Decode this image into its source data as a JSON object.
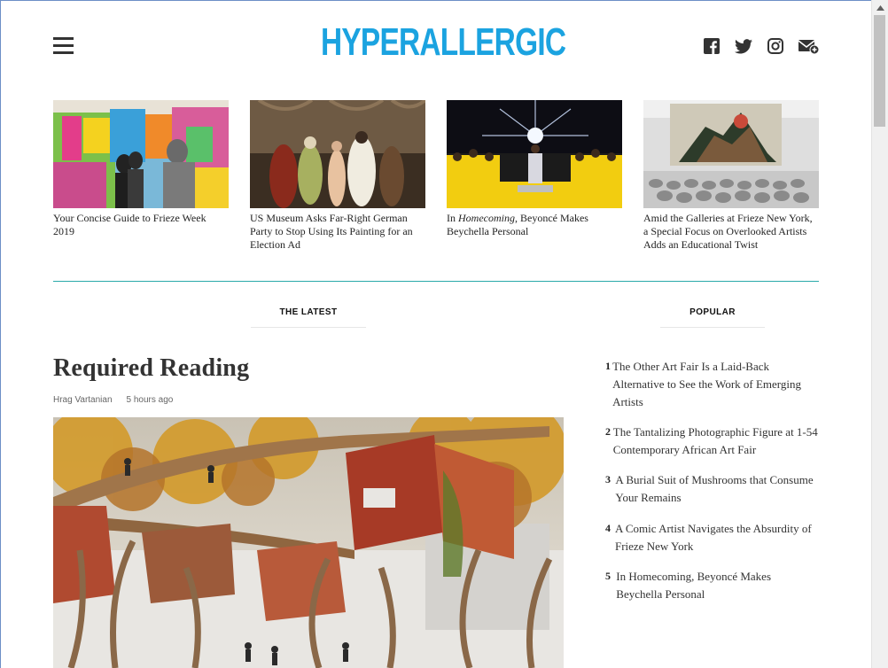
{
  "header": {
    "logo": "HYPERALLERGIC",
    "menu_icon": "hamburger-menu-icon",
    "social_icons": [
      "facebook-icon",
      "twitter-icon",
      "instagram-icon",
      "newsletter-icon"
    ]
  },
  "featured": [
    {
      "caption": "Your Concise Guide to Frieze Week 2019"
    },
    {
      "caption": "US Museum Asks Far-Right German Party to Stop Using Its Painting for an Election Ad"
    },
    {
      "caption_prefix": "In ",
      "caption_em": "Homecoming",
      "caption_suffix": ", Beyoncé Makes Beychella Personal"
    },
    {
      "caption": "Amid the Galleries at Frieze New York, a Special Focus on Overlooked Artists Adds an Educational Twist"
    }
  ],
  "tabs": {
    "latest": "THE LATEST",
    "popular": "POPULAR"
  },
  "latest": {
    "title": "Required Reading",
    "author": "Hrag Vartanian",
    "time": "5 hours ago"
  },
  "popular": [
    {
      "num": "1",
      "title": "The Other Art Fair Is a Laid-Back Alternative to See the Work of Emerging Artists"
    },
    {
      "num": "2",
      "title": "The Tantalizing Photographic Figure at 1-54 Contemporary African Art Fair"
    },
    {
      "num": "3",
      "title": "A Burial Suit of Mushrooms that Consume Your Remains"
    },
    {
      "num": "4",
      "title": "A Comic Artist Navigates the Absurdity of Frieze New York"
    },
    {
      "num": "5",
      "title": "In Homecoming, Beyoncé Makes Beychella Personal"
    }
  ],
  "colors": {
    "brand": "#1ba3e0",
    "divider": "#2aa9a9"
  }
}
